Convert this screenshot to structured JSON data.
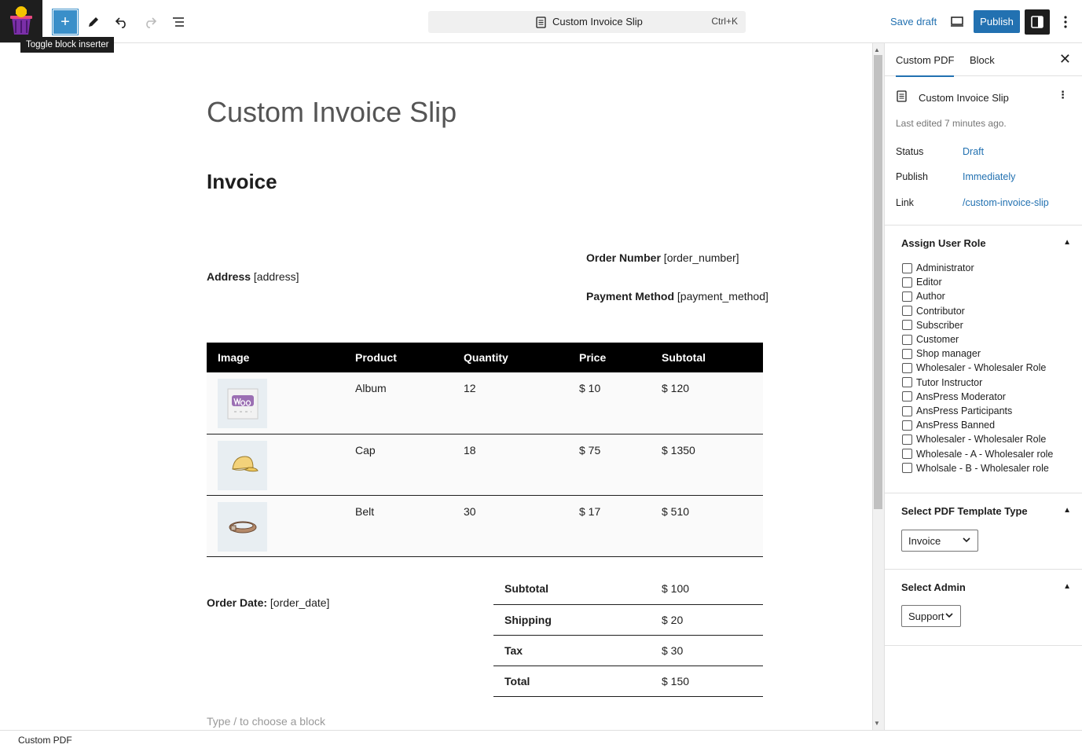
{
  "toolbar": {
    "tooltip": "Toggle block inserter",
    "command_title": "Custom Invoice Slip",
    "command_shortcut": "Ctrl+K",
    "save_draft": "Save draft",
    "publish": "Publish"
  },
  "document": {
    "title": "Custom Invoice Slip",
    "heading": "Invoice",
    "order_number_label": "Order Number",
    "order_number_value": " [order_number]",
    "address_label": "Address",
    "address_value": " [address]",
    "payment_label": "Payment Method",
    "payment_value": " [payment_method]",
    "table_headers": [
      "Image",
      "Product",
      "Quantity",
      "Price",
      "Subtotal"
    ],
    "rows": [
      {
        "product": "Album",
        "quantity": "12",
        "price": "$ 10",
        "subtotal": "$ 120",
        "icon": "album-image-icon"
      },
      {
        "product": "Cap",
        "quantity": "18",
        "price": "$ 75",
        "subtotal": "$ 1350",
        "icon": "cap-image-icon"
      },
      {
        "product": "Belt",
        "quantity": "30",
        "price": "$ 17",
        "subtotal": "$ 510",
        "icon": "belt-image-icon"
      }
    ],
    "order_date_label": "Order Date:",
    "order_date_value": " [order_date]",
    "totals": [
      {
        "label": "Subtotal",
        "value": "$ 100"
      },
      {
        "label": "Shipping",
        "value": "$ 20"
      },
      {
        "label": "Tax",
        "value": "$ 30"
      },
      {
        "label": "Total",
        "value": "$ 150"
      }
    ],
    "placeholder": "Type / to choose a block"
  },
  "sidebar": {
    "tab_doc": "Custom PDF",
    "tab_block": "Block",
    "doc_title": "Custom Invoice Slip",
    "last_edited": "Last edited 7 minutes ago.",
    "status_label": "Status",
    "status_value": "Draft",
    "publish_label": "Publish",
    "publish_value": "Immediately",
    "link_label": "Link",
    "link_value": "/custom-invoice-slip",
    "assign_role_title": "Assign User Role",
    "roles": [
      "Administrator",
      "Editor",
      "Author",
      "Contributor",
      "Subscriber",
      "Customer",
      "Shop manager",
      "Wholesaler - Wholesaler Role",
      "Tutor Instructor",
      "AnsPress Moderator",
      "AnsPress Participants",
      "AnsPress Banned",
      "Wholesaler - Wholesaler Role",
      "Wholesale - A - Wholesaler role",
      "Wholsale - B - Wholesaler role"
    ],
    "template_title": "Select PDF Template Type",
    "template_value": "Invoice",
    "admin_title": "Select Admin",
    "admin_value": "Support"
  },
  "statusbar": {
    "breadcrumb": "Custom PDF"
  },
  "colors": {
    "accent": "#2271b1",
    "inserter": "#3a8fc9"
  }
}
